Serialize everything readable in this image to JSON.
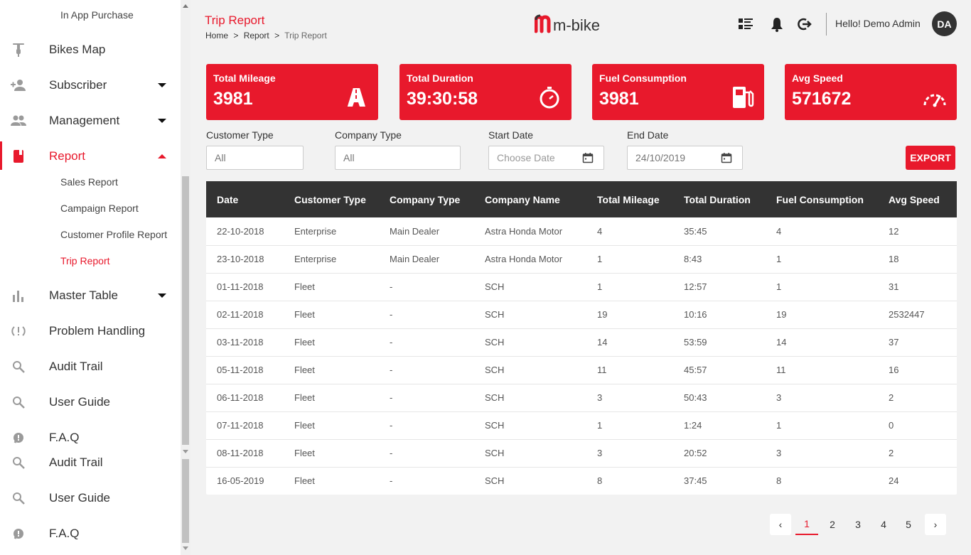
{
  "sidebar": {
    "top_sub": "In App Purchase",
    "items": [
      {
        "label": "Bikes Map",
        "icon": "scooter-icon"
      },
      {
        "label": "Subscriber",
        "icon": "add-user-icon"
      },
      {
        "label": "Management",
        "icon": "users-icon"
      },
      {
        "label": "Report",
        "icon": "report-icon"
      },
      {
        "label": "Master Table",
        "icon": "bar-chart-icon"
      },
      {
        "label": "Problem Handling",
        "icon": "problem-icon"
      },
      {
        "label": "Audit Trail",
        "icon": "search-icon"
      },
      {
        "label": "User Guide",
        "icon": "search-icon"
      },
      {
        "label": "F.A.Q",
        "icon": "faq-icon"
      },
      {
        "label": "Audit Trail",
        "icon": "search-icon"
      },
      {
        "label": "User Guide",
        "icon": "search-icon"
      },
      {
        "label": "F.A.Q",
        "icon": "faq-icon"
      }
    ],
    "report_subitems": [
      "Sales Report",
      "Campaign Report",
      "Customer Profile Report",
      "Trip Report"
    ],
    "active_subitem": "Trip Report"
  },
  "header": {
    "title": "Trip Report",
    "breadcrumb": {
      "home": "Home",
      "sep1": ">",
      "report": "Report",
      "sep2": ">",
      "current": "Trip Report"
    },
    "logo_text": "m-bike",
    "greeting": "Hello! Demo Admin",
    "avatar_initials": "DA"
  },
  "cards": [
    {
      "title": "Total Mileage",
      "value": "3981",
      "icon": "road-icon"
    },
    {
      "title": "Total Duration",
      "value": "39:30:58",
      "icon": "stopwatch-icon"
    },
    {
      "title": "Fuel Consumption",
      "value": "3981",
      "icon": "fuel-pump-icon"
    },
    {
      "title": "Avg Speed",
      "value": "571672",
      "icon": "speedometer-icon"
    }
  ],
  "filters": {
    "customer_type": {
      "label": "Customer Type",
      "value": "All"
    },
    "company_type": {
      "label": "Company Type",
      "value": "All"
    },
    "start_date": {
      "label": "Start Date",
      "value": "",
      "placeholder": "Choose Date"
    },
    "end_date": {
      "label": "End Date",
      "value": "24/10/2019"
    },
    "export_label": "EXPORT"
  },
  "table": {
    "columns": [
      "Date",
      "Customer Type",
      "Company Type",
      "Company Name",
      "Total Mileage",
      "Total Duration",
      "Fuel Consumption",
      "Avg Speed"
    ],
    "rows": [
      [
        "22-10-2018",
        "Enterprise",
        "Main Dealer",
        "Astra Honda Motor",
        "4",
        "35:45",
        "4",
        "12"
      ],
      [
        "23-10-2018",
        "Enterprise",
        "Main Dealer",
        "Astra Honda Motor",
        "1",
        "8:43",
        "1",
        "18"
      ],
      [
        "01-11-2018",
        "Fleet",
        "-",
        "SCH",
        "1",
        "12:57",
        "1",
        "31"
      ],
      [
        "02-11-2018",
        "Fleet",
        "-",
        "SCH",
        "19",
        "10:16",
        "19",
        "2532447"
      ],
      [
        "03-11-2018",
        "Fleet",
        "-",
        "SCH",
        "14",
        "53:59",
        "14",
        "37"
      ],
      [
        "05-11-2018",
        "Fleet",
        "-",
        "SCH",
        "11",
        "45:57",
        "11",
        "16"
      ],
      [
        "06-11-2018",
        "Fleet",
        "-",
        "SCH",
        "3",
        "50:43",
        "3",
        "2"
      ],
      [
        "07-11-2018",
        "Fleet",
        "-",
        "SCH",
        "1",
        "1:24",
        "1",
        "0"
      ],
      [
        "08-11-2018",
        "Fleet",
        "-",
        "SCH",
        "3",
        "20:52",
        "3",
        "2"
      ],
      [
        "16-05-2019",
        "Fleet",
        "-",
        "SCH",
        "8",
        "37:45",
        "8",
        "24"
      ]
    ]
  },
  "pagination": {
    "prev": "‹",
    "pages": [
      "1",
      "2",
      "3",
      "4",
      "5"
    ],
    "active": "1",
    "next": "›"
  },
  "colors": {
    "accent": "#e8192c",
    "table_header": "#333333",
    "background": "#f2f2f2"
  }
}
